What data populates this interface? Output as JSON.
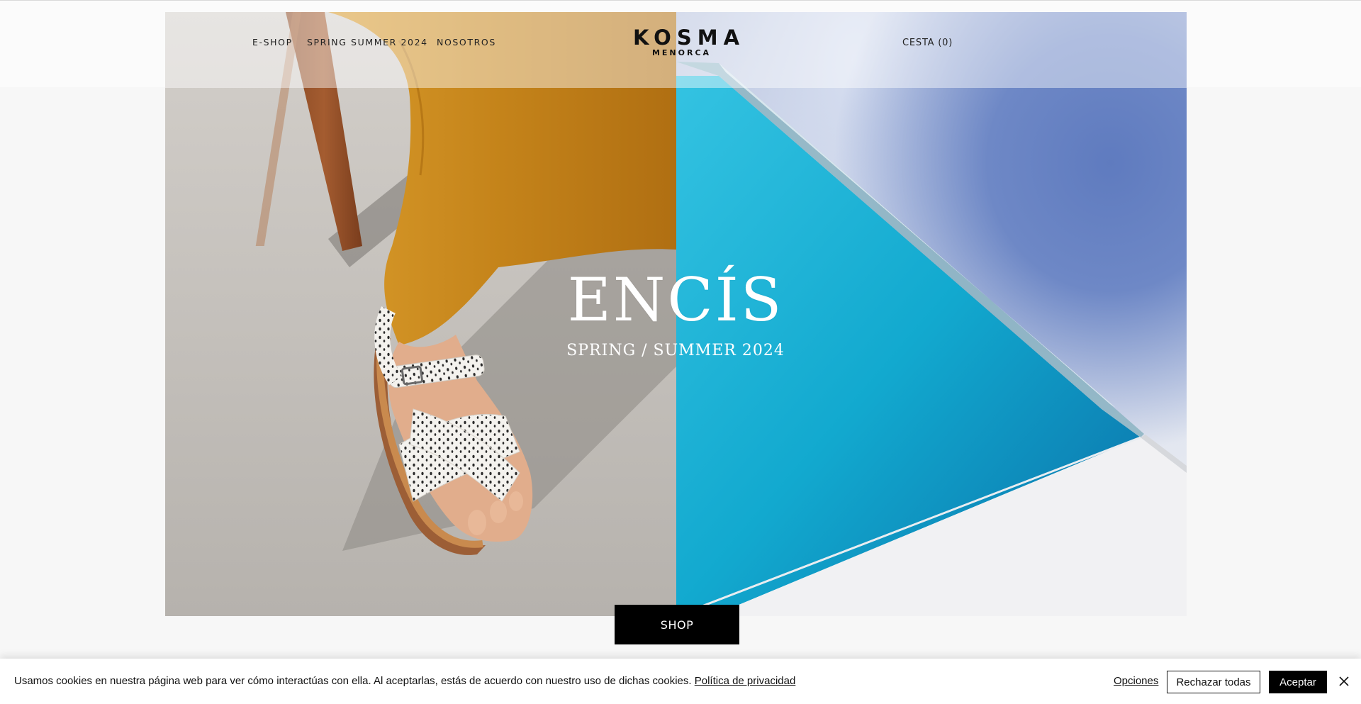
{
  "header": {
    "nav": [
      {
        "label": "E-SHOP"
      },
      {
        "label": "SPRING SUMMER 2024"
      },
      {
        "label": "NOSOTROS"
      }
    ],
    "logo": {
      "main": "KOSMA",
      "sub": "MENORCA"
    },
    "cart_label": "CESTA (0)"
  },
  "hero": {
    "title": "ENCÍS",
    "subtitle": "SPRING / SUMMER 2024",
    "cta_label": "SHOP"
  },
  "cookie_banner": {
    "text": "Usamos cookies en nuestra página web para ver cómo interactúas con ella. Al aceptarlas, estás de acuerdo con nuestro uso de dichas cookies.",
    "privacy_link": "Política de privacidad",
    "options_label": "Opciones",
    "reject_label": "Rechazar todas",
    "accept_label": "Aceptar"
  },
  "colors": {
    "background": "#f7f7f7",
    "text": "#111111",
    "button_bg": "#000000",
    "button_text": "#ffffff",
    "pool_blue": "#1aa9cc",
    "trousers_mustard": "#c98a20"
  },
  "icons": [
    "close-icon"
  ]
}
